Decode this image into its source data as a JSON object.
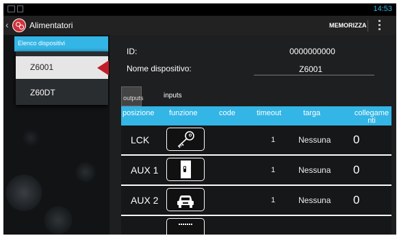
{
  "status_bar": {
    "time": "14:53"
  },
  "action_bar": {
    "title": "Alimentatori",
    "save_label": "MEMORIZZA"
  },
  "device_list": {
    "header": "Elenco dispositivi",
    "items": [
      {
        "label": "Z6001",
        "selected": true
      },
      {
        "label": "Z60DT",
        "selected": false
      }
    ]
  },
  "details": {
    "id_label": "ID:",
    "id_value": "0000000000",
    "name_label": "Nome dispositivo:",
    "name_value": "Z6001"
  },
  "tabs": [
    {
      "label": "outputs",
      "active": true
    },
    {
      "label": "inputs",
      "active": false
    }
  ],
  "table": {
    "headers": [
      "posizione",
      "funzione",
      "code",
      "timeout",
      "targa",
      "collegame nti"
    ],
    "rows": [
      {
        "posizione": "LCK",
        "funzione_icon": "key-icon",
        "code": "",
        "timeout": "1",
        "targa": "Nessuna",
        "collegamenti": "0"
      },
      {
        "posizione": "AUX 1",
        "funzione_icon": "door-icon",
        "code": "",
        "timeout": "1",
        "targa": "Nessuna",
        "collegamenti": "0"
      },
      {
        "posizione": "AUX 2",
        "funzione_icon": "car-icon",
        "code": "",
        "timeout": "1",
        "targa": "Nessuna",
        "collegamenti": "0"
      }
    ]
  },
  "colors": {
    "accent": "#33b5e5",
    "selection_arrow": "#c21e2a"
  }
}
